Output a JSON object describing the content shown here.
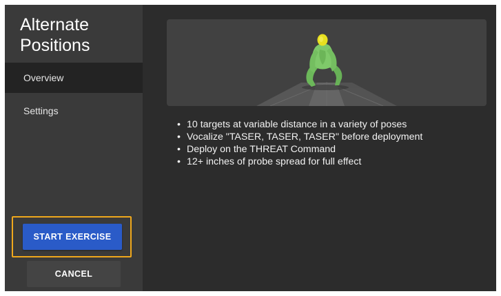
{
  "sidebar": {
    "title": "Alternate Positions",
    "items": [
      {
        "label": "Overview",
        "active": true
      },
      {
        "label": "Settings",
        "active": false
      }
    ]
  },
  "actions": {
    "start_label": "START EXERCISE",
    "cancel_label": "CANCEL"
  },
  "preview": {
    "figure_icon": "crouching-target-figure-icon"
  },
  "bullets": [
    "10 targets at variable distance in a variety of poses",
    "Vocalize \"TASER, TASER, TASER\" before deployment",
    "Deploy on the THREAT Command",
    "12+ inches of probe spread for full effect"
  ],
  "colors": {
    "primary": "#2a5bc8",
    "highlight": "#f0a81c",
    "figure_body": "#7fc96a",
    "figure_head": "#e8e020"
  }
}
